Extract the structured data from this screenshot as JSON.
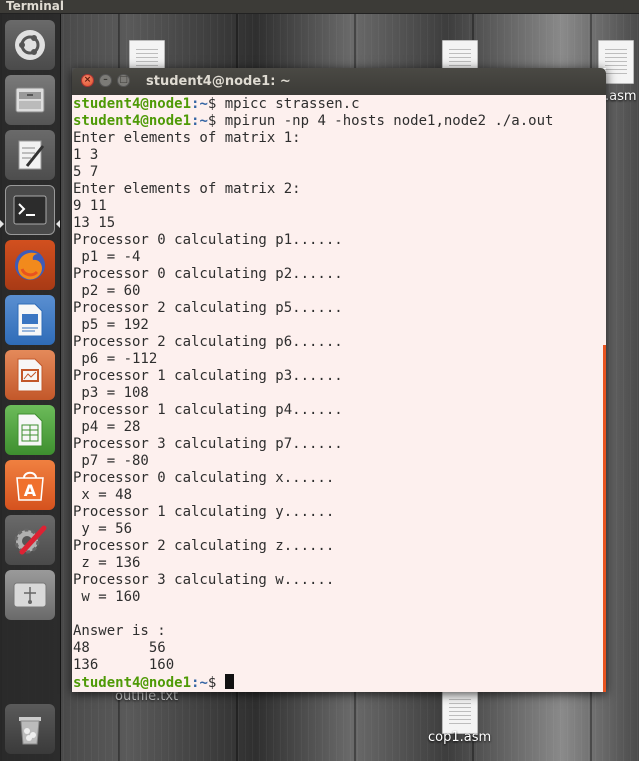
{
  "topbar": {
    "app_name": "Terminal"
  },
  "launcher": {
    "items": [
      {
        "name": "ubuntu-dash-icon"
      },
      {
        "name": "files-icon"
      },
      {
        "name": "text-editor-icon"
      },
      {
        "name": "terminal-icon",
        "active": true
      },
      {
        "name": "firefox-icon"
      },
      {
        "name": "libreoffice-writer-icon"
      },
      {
        "name": "libreoffice-impress-icon"
      },
      {
        "name": "libreoffice-calc-icon"
      },
      {
        "name": "software-center-icon"
      },
      {
        "name": "system-settings-icon"
      },
      {
        "name": "usb-drive-icon"
      }
    ],
    "trash": {
      "name": "trash-icon"
    }
  },
  "desktop": {
    "files": [
      {
        "label": ""
      },
      {
        "label": ""
      },
      {
        "label": ".asm"
      },
      {
        "label": "outfile.txt"
      },
      {
        "label": "cop1.asm"
      }
    ]
  },
  "terminal": {
    "title": "student4@node1: ~",
    "prompt": {
      "user": "student4@node1",
      "path": ":~",
      "symbol": "$ "
    },
    "commands": [
      "mpicc strassen.c",
      "mpirun -np 4 -hosts node1,node2 ./a.out"
    ],
    "output": [
      "Enter elements of matrix 1:",
      "1 3",
      "5 7",
      "Enter elements of matrix 2:",
      "9 11",
      "13 15",
      "Processor 0 calculating p1......",
      " p1 = -4",
      "Processor 0 calculating p2......",
      " p2 = 60",
      "Processor 2 calculating p5......",
      " p5 = 192",
      "Processor 2 calculating p6......",
      " p6 = -112",
      "Processor 1 calculating p3......",
      " p3 = 108",
      "Processor 1 calculating p4......",
      " p4 = 28",
      "Processor 3 calculating p7......",
      " p7 = -80",
      "Processor 0 calculating x......",
      " x = 48",
      "Processor 1 calculating y......",
      " y = 56",
      "Processor 2 calculating z......",
      " z = 136",
      "Processor 3 calculating w......",
      " w = 160",
      "",
      "Answer is :",
      "48       56",
      "136      160"
    ]
  },
  "colors": {
    "terminal_bg": "#fdf0ee",
    "prompt_user": "#4e9a06",
    "prompt_path": "#3465a4",
    "accent": "#e95420"
  }
}
